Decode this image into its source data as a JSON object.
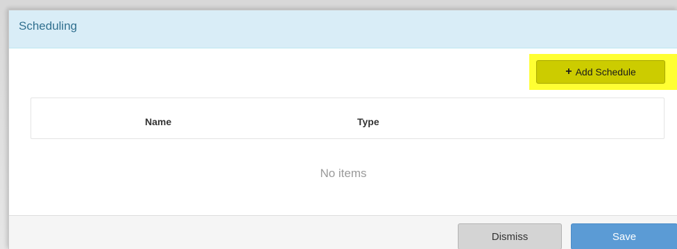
{
  "dialog": {
    "title": "Scheduling"
  },
  "toolbar": {
    "add_schedule_label": "Add Schedule",
    "add_icon": "plus-icon",
    "highlight_color": "#ffff33",
    "button_color": "#cccc00"
  },
  "table": {
    "columns": [
      "Name",
      "Type"
    ],
    "empty_text": "No items"
  },
  "footer": {
    "dismiss_label": "Dismiss",
    "save_label": "Save",
    "save_color": "#5b9bd5"
  }
}
